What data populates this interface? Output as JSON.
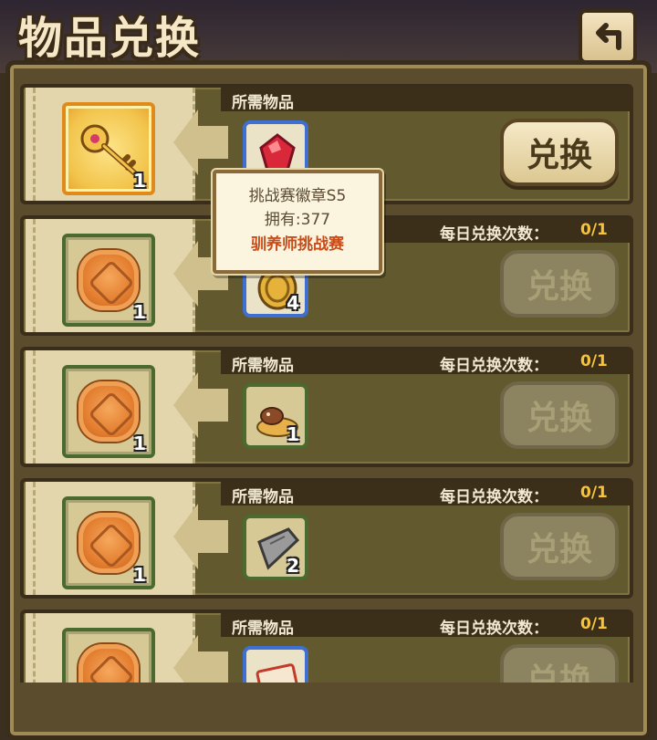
{
  "header": {
    "title": "物品兑换",
    "back_icon": "back-arrow-icon"
  },
  "labels": {
    "required_items": "所需物品",
    "daily_limit": "每日兑换次数："
  },
  "rows": [
    {
      "reward_icon": "golden-key-icon",
      "reward_qty": "1",
      "reward_frame": "gold",
      "required_icon": "red-badge-gem-icon",
      "required_qty": "",
      "daily_count": "",
      "button_label": "兑换",
      "button_state": "active"
    },
    {
      "reward_icon": "mooncake-icon",
      "reward_qty": "1",
      "required_icon": "gold-coin-icon",
      "required_qty": "4",
      "daily_count": "0/1",
      "button_label": "兑换",
      "button_state": "disabled"
    },
    {
      "reward_icon": "mooncake-icon",
      "reward_qty": "1",
      "required_icon": "mushroom-icon",
      "required_qty": "1",
      "daily_count": "0/1",
      "button_label": "兑换",
      "button_state": "disabled"
    },
    {
      "reward_icon": "mooncake-icon",
      "reward_qty": "1",
      "required_icon": "stone-slab-icon",
      "required_qty": "2",
      "daily_count": "0/1",
      "button_label": "兑换",
      "button_state": "disabled"
    },
    {
      "reward_icon": "mooncake-icon",
      "reward_qty": "",
      "required_icon": "ticket-icon",
      "required_qty": "",
      "daily_count": "0/1",
      "button_label": "兑换",
      "button_state": "disabled"
    }
  ],
  "tooltip": {
    "item_name": "挑战赛徽章S5",
    "owned": "拥有:377",
    "source": "驯养师挑战赛"
  },
  "colors": {
    "accent_count": "#f7c33a",
    "tooltip_source": "#c84b18"
  }
}
